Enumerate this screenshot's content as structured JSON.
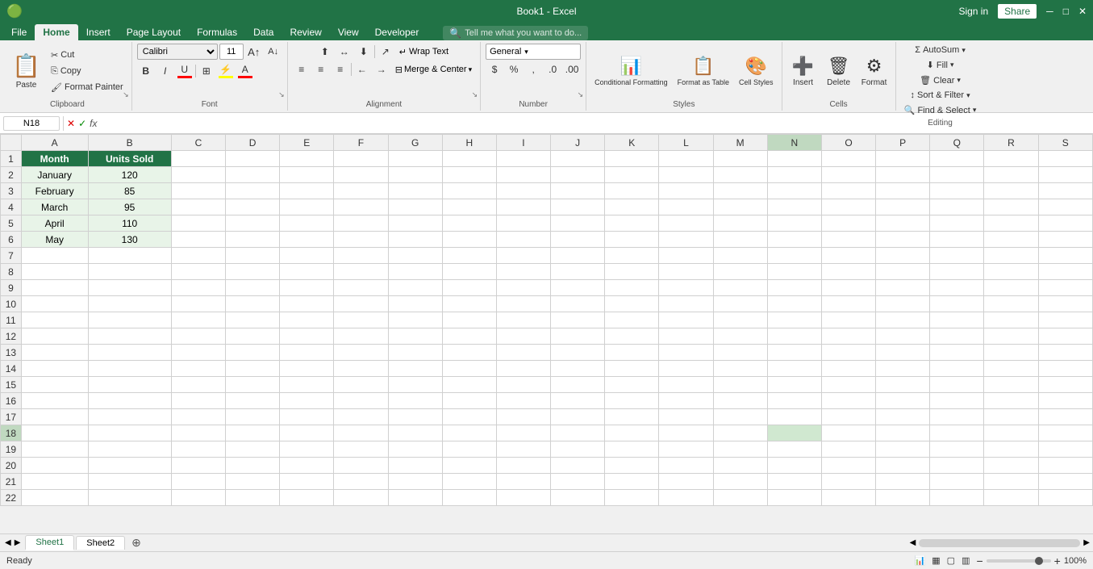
{
  "titleBar": {
    "filename": "Book1 - Excel",
    "signIn": "Sign in",
    "share": "Share"
  },
  "ribbonTabs": {
    "tabs": [
      "File",
      "Home",
      "Insert",
      "Page Layout",
      "Formulas",
      "Data",
      "Review",
      "View",
      "Developer"
    ],
    "activeTab": "Home",
    "searchPlaceholder": "Tell me what you want to do..."
  },
  "clipboard": {
    "groupLabel": "Clipboard",
    "paste": "Paste",
    "cut": "Cut",
    "copy": "Copy",
    "formatPainter": "Format Painter"
  },
  "font": {
    "groupLabel": "Font",
    "fontName": "Calibri",
    "fontSize": "11",
    "bold": "B",
    "italic": "I",
    "underline": "U",
    "borders": "⊞",
    "highlight": "⚡",
    "fontColor": "A"
  },
  "alignment": {
    "groupLabel": "Alignment",
    "wrapText": "Wrap Text",
    "mergeCenter": "Merge & Center"
  },
  "number": {
    "groupLabel": "Number",
    "format": "General"
  },
  "styles": {
    "groupLabel": "Styles",
    "conditionalFormatting": "Conditional Formatting",
    "formatAsTable": "Format as Table",
    "cellStyles": "Cell Styles"
  },
  "cells": {
    "groupLabel": "Cells",
    "insert": "Insert",
    "delete": "Delete",
    "format": "Format"
  },
  "editing": {
    "groupLabel": "Editing",
    "autoSum": "AutoSum",
    "fill": "Fill",
    "clear": "Clear",
    "sortFilter": "Sort & Filter",
    "findSelect": "Find & Select"
  },
  "formulaBar": {
    "cellRef": "N18",
    "formula": ""
  },
  "spreadsheet": {
    "columns": [
      "",
      "A",
      "B",
      "C",
      "D",
      "E",
      "F",
      "G",
      "H",
      "I",
      "J",
      "K",
      "L",
      "M",
      "N",
      "O",
      "P",
      "Q",
      "R",
      "S"
    ],
    "headers": {
      "A": "Month",
      "B": "Units Sold"
    },
    "data": [
      {
        "row": 2,
        "A": "January",
        "B": "120"
      },
      {
        "row": 3,
        "A": "February",
        "B": "85"
      },
      {
        "row": 4,
        "A": "March",
        "B": "95"
      },
      {
        "row": 5,
        "A": "April",
        "B": "110"
      },
      {
        "row": 6,
        "A": "May",
        "B": "130"
      }
    ],
    "totalRows": 22,
    "highlightColor": "#217346"
  },
  "sheetTabs": {
    "sheets": [
      "Sheet1",
      "Sheet2"
    ],
    "activeSheet": "Sheet1"
  },
  "statusBar": {
    "status": "Ready",
    "zoom": "100%",
    "viewNormal": "▦",
    "viewPage": "▢",
    "viewBreak": "▥"
  }
}
